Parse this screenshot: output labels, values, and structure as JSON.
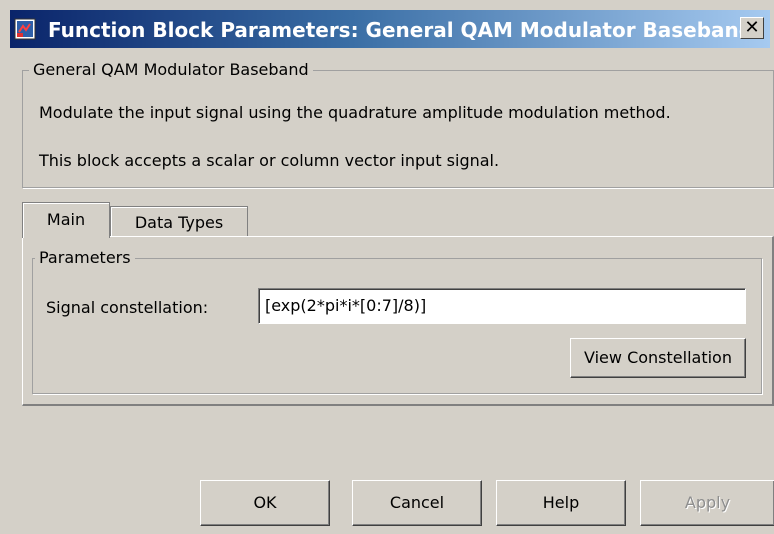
{
  "window": {
    "title": "Function Block Parameters: General QAM Modulator Baseband",
    "close_glyph": "✕"
  },
  "block": {
    "group_title": "General QAM Modulator Baseband",
    "description_1": "Modulate the input signal using the quadrature amplitude modulation method.",
    "description_2": "This block accepts a scalar or column vector input signal."
  },
  "tabs": [
    {
      "label": "Main",
      "active": true
    },
    {
      "label": "Data Types",
      "active": false
    }
  ],
  "parameters": {
    "group_title": "Parameters",
    "signal_constellation_label": "Signal constellation:",
    "signal_constellation_value": "[exp(2*pi*i*[0:7]/8)]",
    "view_constellation_label": "View Constellation"
  },
  "buttons": {
    "ok": "OK",
    "cancel": "Cancel",
    "help": "Help",
    "apply": "Apply",
    "apply_enabled": false
  },
  "icons": {
    "app": "simulink-block-icon",
    "close": "close-icon"
  }
}
